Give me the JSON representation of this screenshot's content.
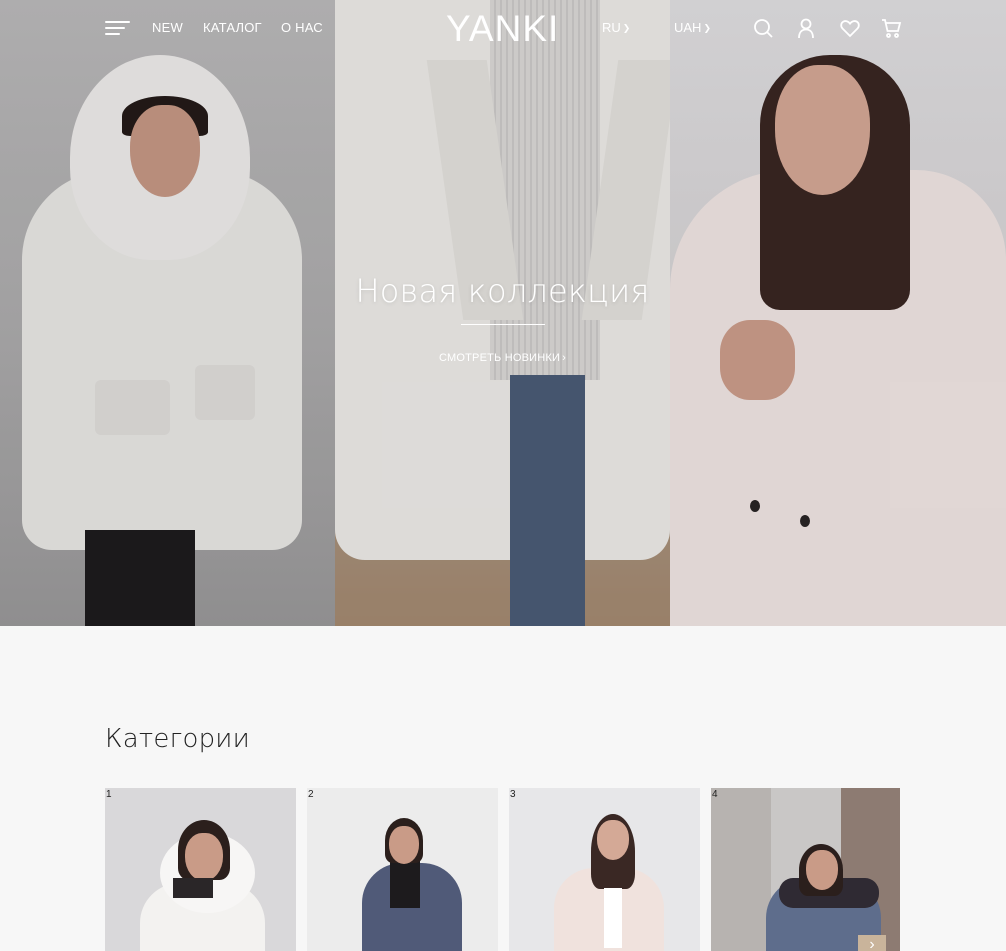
{
  "header": {
    "nav": {
      "new": "NEW",
      "catalog": "КАТАЛОГ",
      "about": "О НАС"
    },
    "logo": "YANKI",
    "language": "RU",
    "currency": "UAH",
    "icons": [
      "burger-menu-icon",
      "search-icon",
      "user-icon",
      "heart-icon",
      "cart-icon"
    ]
  },
  "hero": {
    "title": "Новая коллекция",
    "cta": "СМОТРЕТЬ НОВИНКИ"
  },
  "categories": {
    "title": "Категории",
    "items": [
      {
        "number": "1"
      },
      {
        "number": "2"
      },
      {
        "number": "3"
      },
      {
        "number": "4"
      }
    ]
  },
  "colors": {
    "background": "#f7f7f7",
    "accent": "#c9b49b",
    "text": "#222222",
    "header_text": "#ffffff"
  }
}
